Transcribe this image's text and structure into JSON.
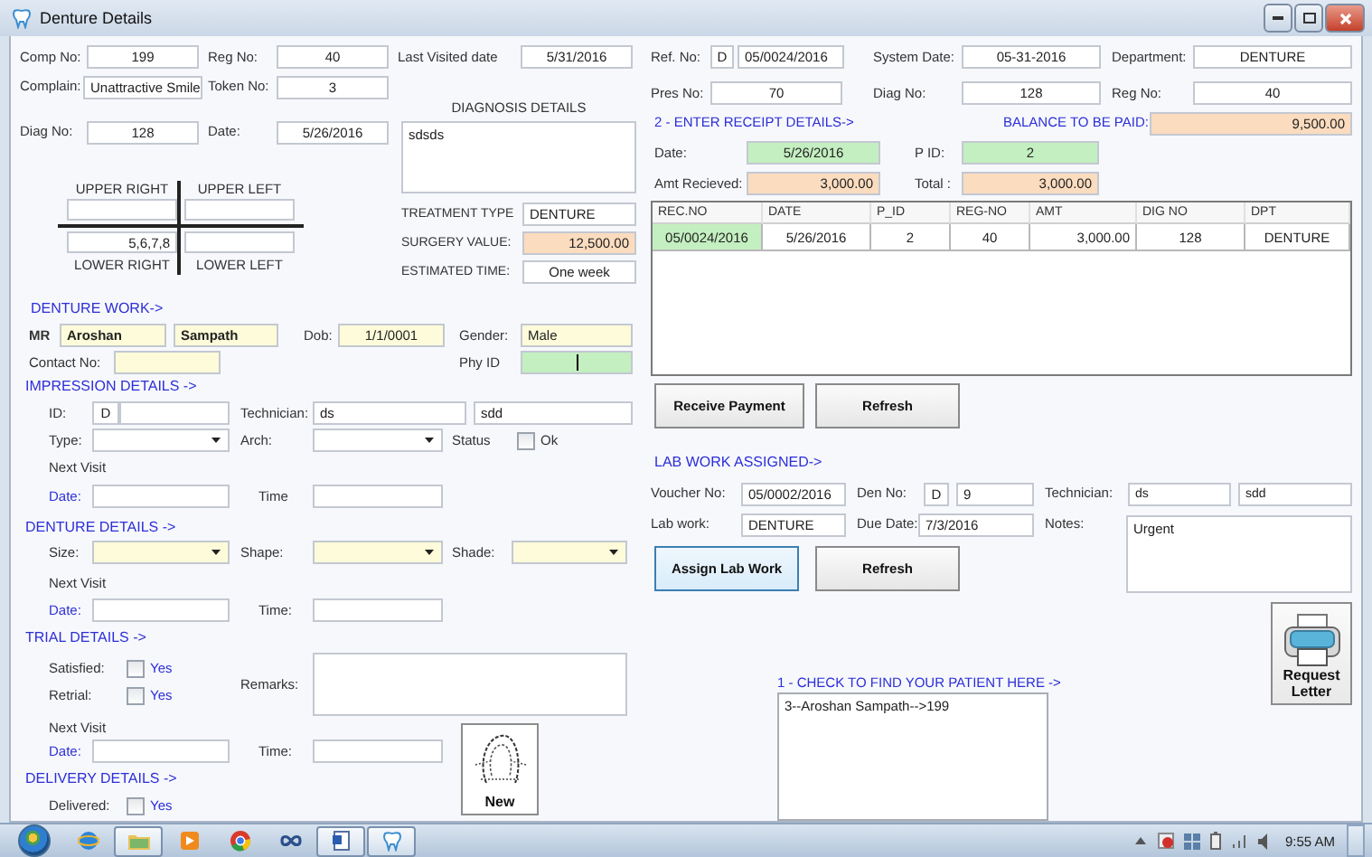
{
  "window": {
    "title": "Denture Details"
  },
  "complaint": {
    "comp_no": {
      "label": "Comp No:",
      "value": "199"
    },
    "reg_no": {
      "label": "Reg No:",
      "value": "40"
    },
    "last_visited": {
      "label": "Last Visited date",
      "value": "5/31/2016"
    },
    "complain": {
      "label": "Complain:",
      "value": "Unattractive Smile"
    },
    "token_no": {
      "label": "Token No:",
      "value": "3"
    }
  },
  "diagnosis": {
    "diag_no": {
      "label": "Diag No:",
      "value": "128"
    },
    "date": {
      "label": "Date:",
      "value": "5/26/2016"
    },
    "title": "DIAGNOSIS DETAILS",
    "details": "sdsds",
    "treatment_type": {
      "label": "TREATMENT TYPE",
      "value": "DENTURE"
    },
    "surgery_value": {
      "label": "SURGERY VALUE:",
      "value": "12,500.00"
    },
    "estimated_time": {
      "label": "ESTIMATED TIME:",
      "value": "One week"
    }
  },
  "teeth_chart": {
    "upper_right": {
      "label": "UPPER RIGHT"
    },
    "upper_left": {
      "label": "UPPER LEFT"
    },
    "lower_right": {
      "label": "LOWER RIGHT",
      "value": "5,6,7,8"
    },
    "lower_left": {
      "label": "LOWER LEFT"
    }
  },
  "denture_work": {
    "heading": "DENTURE WORK->",
    "title": "MR",
    "first_name": "Aroshan",
    "last_name": "Sampath",
    "dob": {
      "label": "Dob:",
      "value": "1/1/0001"
    },
    "gender": {
      "label": "Gender:",
      "value": "Male"
    },
    "contact_no": {
      "label": "Contact No:"
    },
    "phy_id": {
      "label": "Phy ID",
      "focused": true
    }
  },
  "impression": {
    "heading": "IMPRESSION DETAILS ->",
    "id": {
      "label": "ID:",
      "prefix": "D"
    },
    "technician": {
      "label": "Technician:",
      "first": "ds",
      "second": "sdd"
    },
    "type": {
      "label": "Type:"
    },
    "arch": {
      "label": "Arch:"
    },
    "status": {
      "label": "Status",
      "option": "Ok",
      "checked": false
    },
    "next_visit": "Next Visit",
    "date": {
      "label": "Date:"
    },
    "time": {
      "label": "Time"
    }
  },
  "denture_details": {
    "heading": "DENTURE DETAILS ->",
    "size": {
      "label": "Size:"
    },
    "shape": {
      "label": "Shape:"
    },
    "shade": {
      "label": "Shade:"
    },
    "next_visit": "Next Visit",
    "date": {
      "label": "Date:"
    },
    "time": {
      "label": "Time:"
    }
  },
  "trial": {
    "heading": "TRIAL DETAILS ->",
    "satisfied": {
      "label": "Satisfied:",
      "option": "Yes",
      "checked": false
    },
    "retrial": {
      "label": "Retrial:",
      "option": "Yes",
      "checked": false
    },
    "remarks": {
      "label": "Remarks:"
    },
    "next_visit": "Next Visit",
    "date": {
      "label": "Date:"
    },
    "time": {
      "label": "Time:"
    }
  },
  "new_button": {
    "label": "New"
  },
  "delivery": {
    "heading": "DELIVERY DETAILS ->",
    "delivered": {
      "label": "Delivered:",
      "option": "Yes",
      "checked": false
    }
  },
  "reference": {
    "ref_no": {
      "label": "Ref. No:",
      "prefix": "D",
      "value": "05/0024/2016"
    },
    "system_date": {
      "label": "System Date:",
      "value": "05-31-2016"
    },
    "department": {
      "label": "Department:",
      "value": "DENTURE"
    },
    "pres_no": {
      "label": "Pres No:",
      "value": "70"
    },
    "diag_no": {
      "label": "Diag No:",
      "value": "128"
    },
    "reg_no": {
      "label": "Reg No:",
      "value": "40"
    }
  },
  "receipt": {
    "heading": "2 - ENTER RECEIPT DETAILS->",
    "balance": {
      "label": "BALANCE TO BE PAID:",
      "value": "9,500.00"
    },
    "date": {
      "label": "Date:",
      "value": "5/26/2016"
    },
    "p_id": {
      "label": "P ID:",
      "value": "2"
    },
    "amt_received": {
      "label": "Amt Recieved:",
      "value": "3,000.00"
    },
    "total": {
      "label": "Total :",
      "value": "3,000.00"
    }
  },
  "receipts_table": {
    "columns": [
      "REC.NO",
      "DATE",
      "P_ID",
      "REG-NO",
      "AMT",
      "DIG NO",
      "DPT"
    ],
    "rows": [
      {
        "cells": [
          {
            "text": "05/0024/2016",
            "selected": true
          },
          {
            "text": "5/26/2016",
            "selected": false
          },
          {
            "text": "2",
            "selected": false
          },
          {
            "text": "40",
            "selected": false
          },
          {
            "text": "3,000.00",
            "selected": false
          },
          {
            "text": "128",
            "selected": false
          },
          {
            "text": "DENTURE",
            "selected": false
          }
        ]
      }
    ]
  },
  "payment_buttons": [
    {
      "label": "Receive Payment"
    },
    {
      "label": "Refresh"
    }
  ],
  "lab_work": {
    "heading": "LAB WORK ASSIGNED->",
    "voucher_no": {
      "label": "Voucher No:",
      "value": "05/0002/2016"
    },
    "den_no": {
      "label": "Den No:",
      "prefix": "D",
      "value": "9"
    },
    "technician": {
      "label": "Technician:",
      "first": "ds",
      "second": "sdd"
    },
    "lab_work": {
      "label": "Lab work:",
      "value": "DENTURE"
    },
    "due_date": {
      "label": "Due Date:",
      "value": "7/3/2016"
    },
    "notes": {
      "label": "Notes:",
      "value": "Urgent"
    }
  },
  "lab_buttons": [
    {
      "label": "Assign Lab Work",
      "focused": true
    },
    {
      "label": "Refresh",
      "focused": false
    }
  ],
  "request_letter": {
    "label": "Request Letter"
  },
  "patient_search": {
    "heading": "1 - CHECK TO FIND YOUR PATIENT HERE ->",
    "items": [
      "3--Aroshan Sampath-->199"
    ]
  },
  "taskbar": {
    "apps": [
      {
        "kind": "browser",
        "running": false
      },
      {
        "kind": "folder",
        "running": true
      },
      {
        "kind": "media",
        "running": false
      },
      {
        "kind": "chrome",
        "running": false
      },
      {
        "kind": "infinity",
        "running": false
      },
      {
        "kind": "document",
        "running": true
      },
      {
        "kind": "tooth",
        "running": true
      }
    ],
    "clock": "9:55 AM"
  }
}
